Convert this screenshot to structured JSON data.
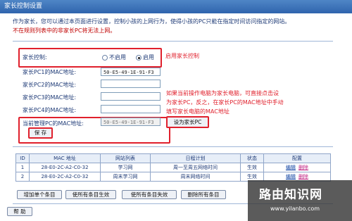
{
  "window": {
    "title": "家长控制设置"
  },
  "description": {
    "line1": "作为家长，您可以通过本页面进行设置，控制小孩的上网行为，使得小孩的PC只能在指定时间访问指定的网站。",
    "warning": "不在规则列表中的非家长PC将无法上网。"
  },
  "form": {
    "control_label": "家长控制:",
    "option_disable": "不启用",
    "option_enable": "启用",
    "selected": "启用",
    "pc1_label": "家长PC1的MAC地址:",
    "pc1_value": "50-E5-49-1E-91-F3",
    "pc2_label": "家长PC2的MAC地址:",
    "pc2_value": "",
    "pc3_label": "家长PC3的MAC地址:",
    "pc3_value": "",
    "pc4_label": "家长PC4的MAC地址:",
    "pc4_value": "",
    "current_label": "当前管理PC的MAC地址:",
    "current_value": "50-E5-49-1E-91-F3",
    "set_parent_button": "设为家长PC",
    "save_button": "保 存"
  },
  "annotations": {
    "enable_note": "启用家长控制",
    "mac_note_1": "如果当前操作电脑为家长电脑，可直接点击设",
    "mac_note_2": "为家长PC，反之，在家长PC的MAC地址中手动",
    "mac_note_3": "填写家长电脑的MAC地址"
  },
  "table": {
    "headers": [
      "ID",
      "MAC 地址",
      "网站列表",
      "日程计划",
      "状态",
      "配置"
    ],
    "rows": [
      {
        "id": "1",
        "mac": "28-E0-2C-A2-C0-32",
        "sites": "学习网",
        "schedule": "周一至周五网络时间",
        "status": "生效",
        "edit": "编辑",
        "delete": "删除"
      },
      {
        "id": "2",
        "mac": "28-E0-2C-A2-C0-32",
        "sites": "周末学习网",
        "schedule": "周末网络时间",
        "status": "生效",
        "edit": "编辑",
        "delete": "删除"
      }
    ]
  },
  "buttons": {
    "add": "增加单个条目",
    "enable_all": "使所有条目生效",
    "disable_all": "使所有条目失效",
    "delete_all": "删除所有条目",
    "help": "帮 助"
  },
  "watermark": {
    "title": "路由知识网",
    "url": "www.yilanbo.com"
  }
}
